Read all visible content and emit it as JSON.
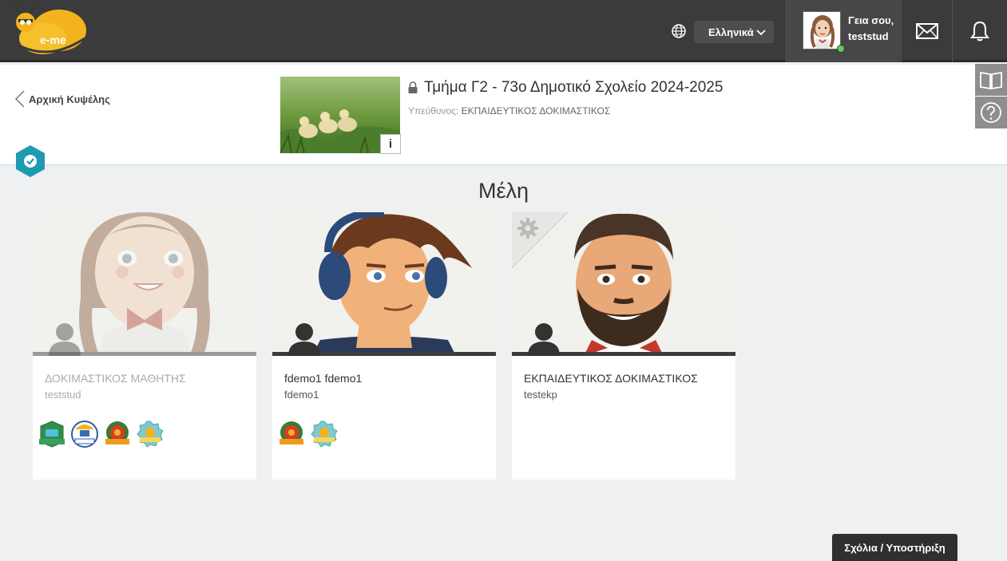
{
  "app": {
    "logo_text": "e-me"
  },
  "topbar": {
    "language": "Ελληνικά",
    "greeting": "Γεια σου,",
    "username": "teststud"
  },
  "header": {
    "back_label": "Αρχική Κυψέλης",
    "title": "Τμήμα Γ2 - 73ο Δημοτικό Σχολείο 2024-2025",
    "responsible_label": "Υπεύθυνος:",
    "responsible_name": "ΕΚΠΑΙΔΕΥΤΙΚΟΣ ΔΟΚΙΜΑΣΤΙΚΟΣ",
    "info_label": "i"
  },
  "section_title": "Μέλη",
  "members": [
    {
      "name": "ΔΟΚΙΜΑΣΤΙΚΟΣ ΜΑΘΗΤΗΣ",
      "username": "teststud",
      "badges": [
        "green-badge-icon",
        "blue-badge-icon",
        "orange-badge-icon",
        "teal-badge-icon"
      ]
    },
    {
      "name": "fdemo1 fdemo1",
      "username": "fdemo1",
      "badges": [
        "orange-badge-icon",
        "teal-badge-icon"
      ]
    },
    {
      "name": "ΕΚΠΑΙΔΕΥΤΙΚΟΣ ΔΟΚΙΜΑΣΤΙΚΟΣ",
      "username": "testekp",
      "badges": []
    }
  ],
  "footer": {
    "support_label": "Σχόλια / Υποστήριξη"
  },
  "colors": {
    "topbar": "#3b3b3b",
    "accent_teal": "#1e9bb0",
    "background": "#eff0f2",
    "online": "#5fcf5a"
  }
}
